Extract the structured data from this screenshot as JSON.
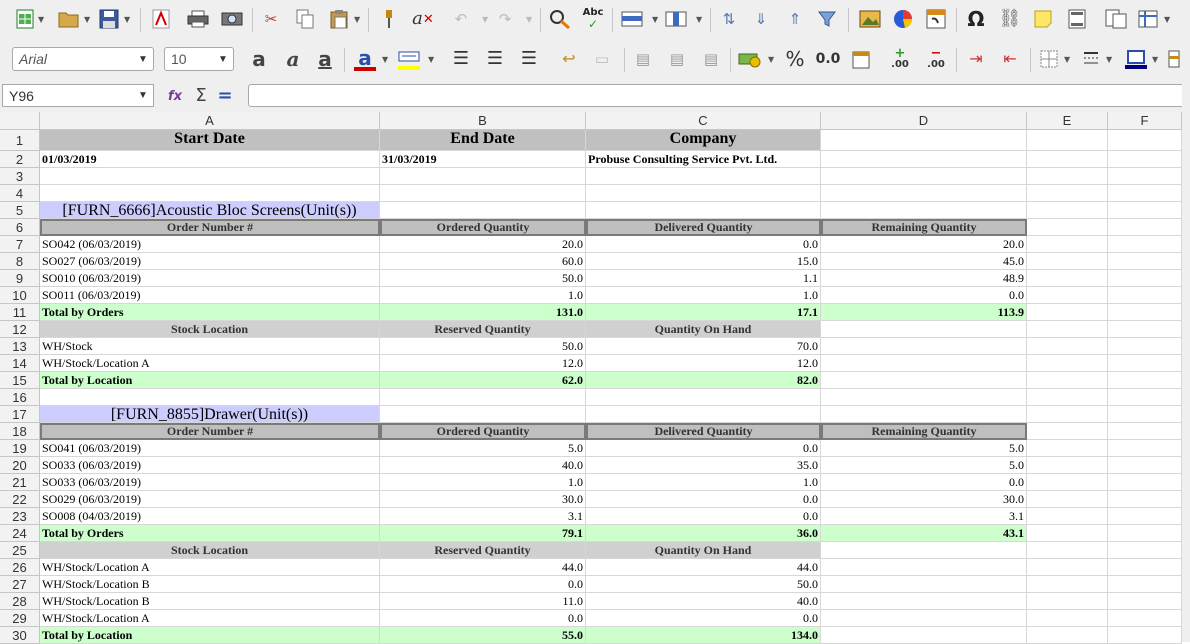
{
  "toolbar": {
    "font_name": "Arial",
    "font_size": "10",
    "glyph_special_char": "Ω",
    "glyph_percent": "%",
    "glyph_number_format": "0.0",
    "glyph_add_decimal": ".00",
    "glyph_del_decimal": ".00",
    "glyph_spellcheck": "Abc",
    "glyph_bold": "a",
    "glyph_italic": "a",
    "glyph_underline": "a",
    "glyph_font_color": "a",
    "colors": {
      "font_color": "#cc0000",
      "highlight": "#ffff00",
      "accent": "#e8c000"
    }
  },
  "formula_bar": {
    "cell_ref": "Y96",
    "function_glyph": "fx",
    "sum_glyph": "Σ",
    "equals_glyph": "="
  },
  "columns": [
    "A",
    "B",
    "C",
    "D",
    "E",
    "F"
  ],
  "rows": [
    "1",
    "2",
    "3",
    "4",
    "5",
    "6",
    "7",
    "8",
    "9",
    "10",
    "11",
    "12",
    "13",
    "14",
    "15",
    "16",
    "17",
    "18",
    "19",
    "20",
    "21",
    "22",
    "23",
    "24",
    "25",
    "26",
    "27",
    "28",
    "29",
    "30"
  ],
  "sheet": {
    "header": {
      "start_date_label": "Start Date",
      "end_date_label": "End Date",
      "company_label": "Company",
      "start_date": "01/03/2019",
      "end_date": "31/03/2019",
      "company": "Probuse Consulting Service Pvt. Ltd."
    },
    "order_columns": [
      "Order Number #",
      "Ordered Quantity",
      "Delivered Quantity",
      "Remaining Quantity"
    ],
    "location_columns": [
      "Stock Location",
      "Reserved Quantity",
      "Quantity On Hand"
    ],
    "products": [
      {
        "title": "[FURN_6666]Acoustic Bloc Screens(Unit(s))",
        "orders": [
          [
            "SO042 (06/03/2019)",
            "20.0",
            "0.0",
            "20.0"
          ],
          [
            "SO027 (06/03/2019)",
            "60.0",
            "15.0",
            "45.0"
          ],
          [
            "SO010 (06/03/2019)",
            "50.0",
            "1.1",
            "48.9"
          ],
          [
            "SO011 (06/03/2019)",
            "1.0",
            "1.0",
            "0.0"
          ]
        ],
        "order_total": [
          "Total by Orders",
          "131.0",
          "17.1",
          "113.9"
        ],
        "locations": [
          [
            "WH/Stock",
            "50.0",
            "70.0"
          ],
          [
            "WH/Stock/Location A",
            "12.0",
            "12.0"
          ]
        ],
        "location_total": [
          "Total by Location",
          "62.0",
          "82.0"
        ]
      },
      {
        "title": "[FURN_8855]Drawer(Unit(s))",
        "orders": [
          [
            "SO041 (06/03/2019)",
            "5.0",
            "0.0",
            "5.0"
          ],
          [
            "SO033 (06/03/2019)",
            "40.0",
            "35.0",
            "5.0"
          ],
          [
            "SO033 (06/03/2019)",
            "1.0",
            "1.0",
            "0.0"
          ],
          [
            "SO029 (06/03/2019)",
            "30.0",
            "0.0",
            "30.0"
          ],
          [
            "SO008 (04/03/2019)",
            "3.1",
            "0.0",
            "3.1"
          ]
        ],
        "order_total": [
          "Total by Orders",
          "79.1",
          "36.0",
          "43.1"
        ],
        "locations": [
          [
            "WH/Stock/Location A",
            "44.0",
            "44.0"
          ],
          [
            "WH/Stock/Location B",
            "0.0",
            "50.0"
          ],
          [
            "WH/Stock/Location B",
            "11.0",
            "40.0"
          ],
          [
            "WH/Stock/Location A",
            "0.0",
            "0.0"
          ]
        ],
        "location_total": [
          "Total by Location",
          "55.0",
          "134.0"
        ]
      }
    ]
  }
}
